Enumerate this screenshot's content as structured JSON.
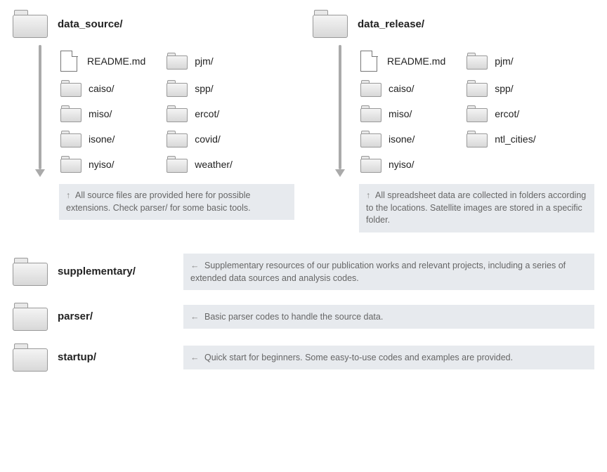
{
  "top": [
    {
      "name": "data_source/",
      "items": [
        {
          "type": "file",
          "label": "README.md"
        },
        {
          "type": "folder",
          "label": "pjm/"
        },
        {
          "type": "folder",
          "label": "caiso/"
        },
        {
          "type": "folder",
          "label": "spp/"
        },
        {
          "type": "folder",
          "label": "miso/"
        },
        {
          "type": "folder",
          "label": "ercot/"
        },
        {
          "type": "folder",
          "label": "isone/"
        },
        {
          "type": "folder",
          "label": "covid/"
        },
        {
          "type": "folder",
          "label": "nyiso/"
        },
        {
          "type": "folder",
          "label": "weather/"
        }
      ],
      "note": "All source files are provided here for possible extensions. Check parser/ for some basic tools."
    },
    {
      "name": "data_release/",
      "items": [
        {
          "type": "file",
          "label": "README.md"
        },
        {
          "type": "folder",
          "label": "pjm/"
        },
        {
          "type": "folder",
          "label": "caiso/"
        },
        {
          "type": "folder",
          "label": "spp/"
        },
        {
          "type": "folder",
          "label": "miso/"
        },
        {
          "type": "folder",
          "label": "ercot/"
        },
        {
          "type": "folder",
          "label": "isone/"
        },
        {
          "type": "folder",
          "label": "ntl_cities/"
        },
        {
          "type": "folder",
          "label": "nyiso/"
        }
      ],
      "note": "All spreadsheet data are collected in folders according to the locations. Satellite images are stored in a specific folder."
    }
  ],
  "bottom": [
    {
      "name": "supplementary/",
      "desc": "Supplementary resources of our publication works and relevant projects, including a series of extended data sources and analysis codes."
    },
    {
      "name": "parser/",
      "desc": "Basic parser codes to handle the source data."
    },
    {
      "name": "startup/",
      "desc": "Quick start for beginners. Some easy-to-use codes and examples are provided."
    }
  ]
}
